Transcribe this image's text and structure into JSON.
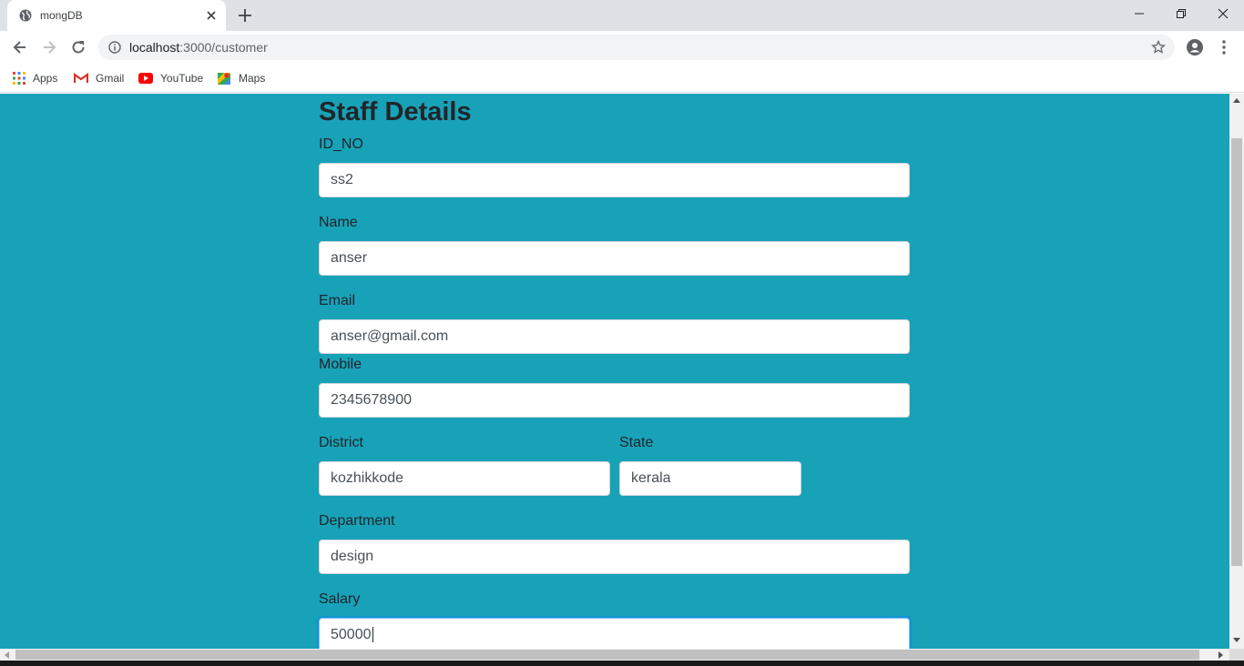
{
  "browser": {
    "tab_title": "mongDB",
    "url_host": "localhost",
    "url_path": ":3000/customer",
    "bookmarks": [
      {
        "label": "Apps",
        "icon": "apps-grid-icon"
      },
      {
        "label": "Gmail",
        "icon": "gmail-icon"
      },
      {
        "label": "YouTube",
        "icon": "youtube-icon"
      },
      {
        "label": "Maps",
        "icon": "maps-icon"
      }
    ]
  },
  "colors": {
    "page_background": "#17a2b8",
    "text": "#212529",
    "focus_border": "#80bdff"
  },
  "form": {
    "title": "Staff Details",
    "id_no": {
      "label": "ID_NO",
      "value": "ss2"
    },
    "name": {
      "label": "Name",
      "value": "anser"
    },
    "email": {
      "label": "Email",
      "value": "anser@gmail.com"
    },
    "mobile": {
      "label": "Mobile",
      "value": "2345678900"
    },
    "district": {
      "label": "District",
      "value": "kozhikkode"
    },
    "state": {
      "label": "State",
      "value": "kerala"
    },
    "department": {
      "label": "Department",
      "value": "design"
    },
    "salary": {
      "label": "Salary",
      "value": "50000"
    }
  }
}
